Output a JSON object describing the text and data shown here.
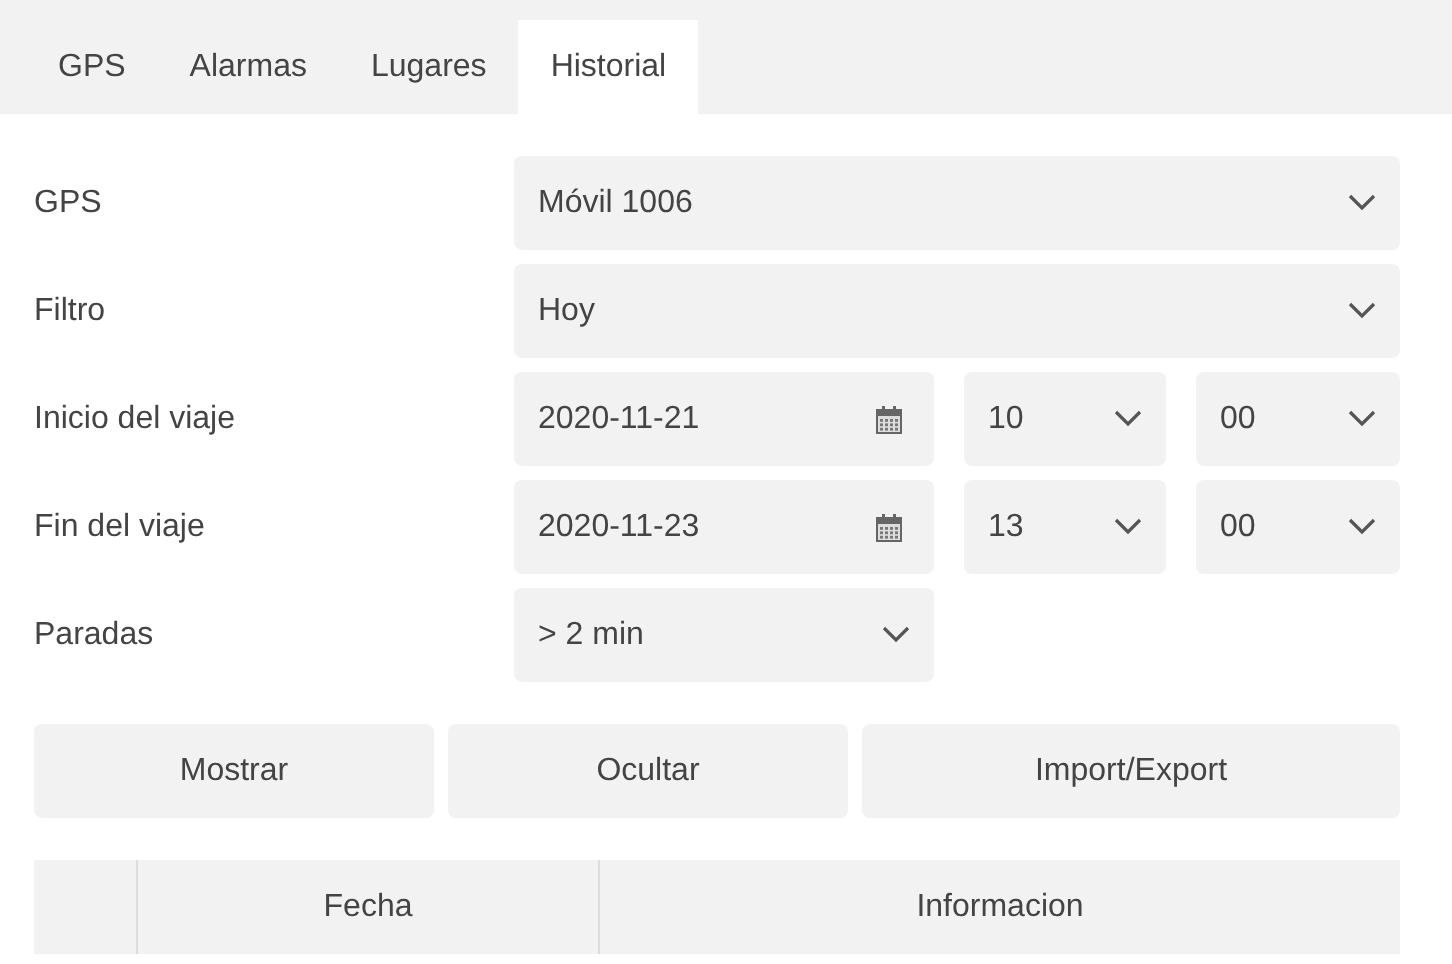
{
  "tabs": [
    {
      "label": "GPS",
      "selected": false
    },
    {
      "label": "Alarmas",
      "selected": false
    },
    {
      "label": "Lugares",
      "selected": false
    },
    {
      "label": "Historial",
      "selected": true
    }
  ],
  "form": [
    {
      "kind": "select",
      "label": "GPS",
      "value": "Móvil 1006"
    },
    {
      "kind": "select",
      "label": "Filtro",
      "value": "Hoy"
    },
    {
      "kind": "datetime",
      "label": "Inicio del viaje",
      "date": "2020-11-21",
      "hour": "10",
      "minute": "00"
    },
    {
      "kind": "datetime",
      "label": "Fin del viaje",
      "date": "2020-11-23",
      "hour": "13",
      "minute": "00"
    },
    {
      "kind": "short_select",
      "label": "Paradas",
      "value": "> 2 min"
    }
  ],
  "buttons": [
    "Mostrar",
    "Ocultar",
    "Import/Export"
  ],
  "table": {
    "columns": [
      "",
      "Fecha",
      "Informacion"
    ]
  }
}
